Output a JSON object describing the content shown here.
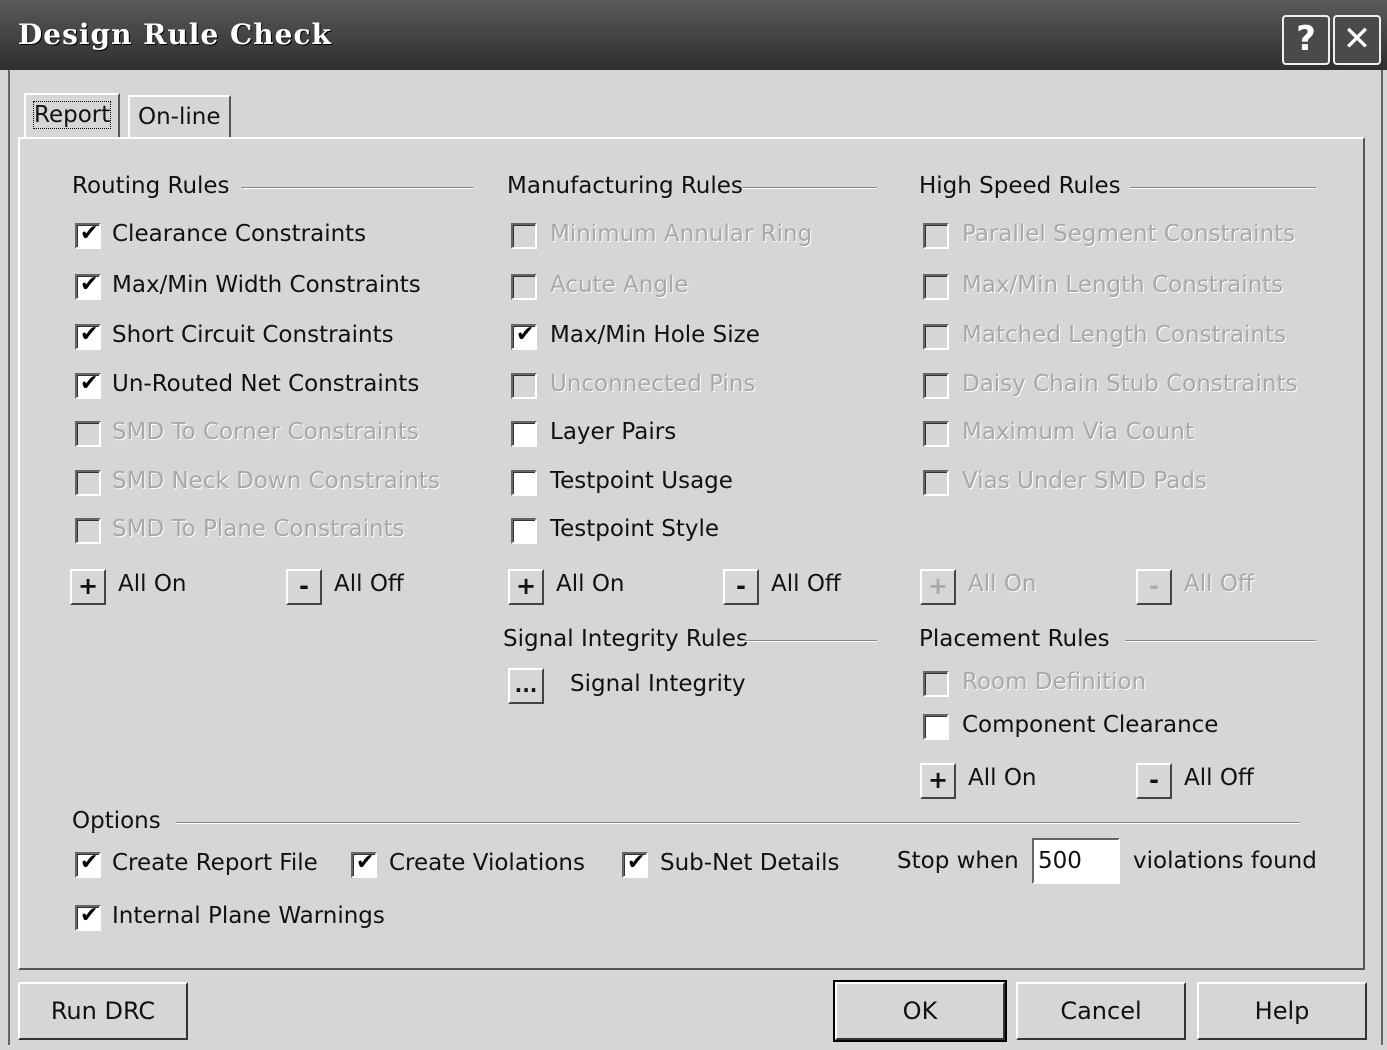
{
  "window": {
    "title": "Design Rule Check",
    "help_label": "?",
    "close_label": "✕"
  },
  "tabs": [
    {
      "label": "Report",
      "active": true
    },
    {
      "label": "On-line",
      "active": false
    }
  ],
  "routing": {
    "header": "Routing Rules",
    "items": [
      {
        "label": "Clearance Constraints",
        "checked": true,
        "enabled": true
      },
      {
        "label": "Max/Min Width Constraints",
        "checked": true,
        "enabled": true
      },
      {
        "label": "Short Circuit Constraints",
        "checked": true,
        "enabled": true
      },
      {
        "label": "Un-Routed Net Constraints",
        "checked": true,
        "enabled": true
      },
      {
        "label": "SMD To Corner Constraints",
        "checked": false,
        "enabled": false
      },
      {
        "label": "SMD Neck Down Constraints",
        "checked": false,
        "enabled": false
      },
      {
        "label": "SMD To Plane Constraints",
        "checked": false,
        "enabled": false
      }
    ],
    "all_on": "All On",
    "all_off": "All Off",
    "enabled": true
  },
  "manufacturing": {
    "header": "Manufacturing Rules",
    "items": [
      {
        "label": "Minimum Annular Ring",
        "checked": false,
        "enabled": false
      },
      {
        "label": "Acute Angle",
        "checked": false,
        "enabled": false
      },
      {
        "label": "Max/Min Hole Size",
        "checked": true,
        "enabled": true
      },
      {
        "label": "Unconnected Pins",
        "checked": false,
        "enabled": false
      },
      {
        "label": "Layer Pairs",
        "checked": false,
        "enabled": true
      },
      {
        "label": "Testpoint Usage",
        "checked": false,
        "enabled": true
      },
      {
        "label": "Testpoint Style",
        "checked": false,
        "enabled": true
      }
    ],
    "all_on": "All On",
    "all_off": "All Off",
    "enabled": true
  },
  "high_speed": {
    "header": "High Speed Rules",
    "items": [
      {
        "label": "Parallel Segment Constraints",
        "checked": false,
        "enabled": false
      },
      {
        "label": "Max/Min Length Constraints",
        "checked": false,
        "enabled": false
      },
      {
        "label": "Matched Length Constraints",
        "checked": false,
        "enabled": false
      },
      {
        "label": "Daisy Chain Stub Constraints",
        "checked": false,
        "enabled": false
      },
      {
        "label": "Maximum Via Count",
        "checked": false,
        "enabled": false
      },
      {
        "label": "Vias Under SMD Pads",
        "checked": false,
        "enabled": false
      }
    ],
    "all_on": "All On",
    "all_off": "All Off",
    "enabled": false
  },
  "signal_integrity": {
    "header": "Signal Integrity Rules",
    "button": "...",
    "label": "Signal Integrity"
  },
  "placement": {
    "header": "Placement Rules",
    "items": [
      {
        "label": "Room Definition",
        "checked": false,
        "enabled": false
      },
      {
        "label": "Component Clearance",
        "checked": false,
        "enabled": true
      }
    ],
    "all_on": "All On",
    "all_off": "All Off",
    "enabled": true
  },
  "options": {
    "header": "Options",
    "items": [
      {
        "label": "Create Report File",
        "checked": true,
        "enabled": true
      },
      {
        "label": "Create Violations",
        "checked": true,
        "enabled": true
      },
      {
        "label": "Sub-Net Details",
        "checked": true,
        "enabled": true
      },
      {
        "label": "Internal Plane Warnings",
        "checked": true,
        "enabled": true
      }
    ],
    "stop_when": "Stop when",
    "stop_value": "500",
    "violations_found": "violations found"
  },
  "buttons": {
    "run_drc": "Run DRC",
    "ok": "OK",
    "cancel": "Cancel",
    "help": "Help"
  }
}
